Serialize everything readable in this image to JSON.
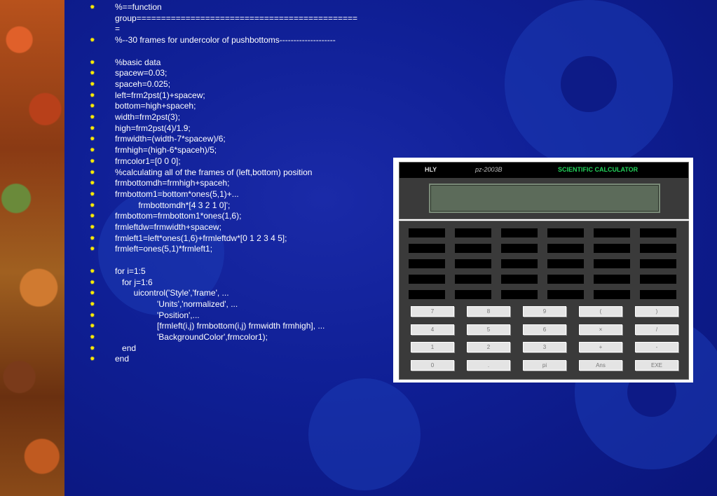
{
  "code_lines": [
    {
      "text": "%==function group=============================================",
      "bullet": true
    },
    {
      "text": "=",
      "bullet": false
    },
    {
      "text": "%--30 frames for undercolor of pushbottoms--------------------",
      "bullet": true
    },
    {
      "text": "",
      "bullet": false
    },
    {
      "text": "%basic data",
      "bullet": true
    },
    {
      "text": "spacew=0.03;",
      "bullet": true
    },
    {
      "text": "spaceh=0.025;",
      "bullet": true
    },
    {
      "text": "left=frm2pst(1)+spacew;",
      "bullet": true
    },
    {
      "text": "bottom=high+spaceh;",
      "bullet": true
    },
    {
      "text": "width=frm2pst(3);",
      "bullet": true
    },
    {
      "text": "high=frm2pst(4)/1.9;",
      "bullet": true
    },
    {
      "text": "frmwidth=(width-7*spacew)/6;",
      "bullet": true
    },
    {
      "text": "frmhigh=(high-6*spaceh)/5;",
      "bullet": true
    },
    {
      "text": "frmcolor1=[0 0 0];",
      "bullet": true
    },
    {
      "text": "%calculating all of the frames of (left,bottom) position",
      "bullet": true
    },
    {
      "text": "frmbottomdh=frmhigh+spaceh;",
      "bullet": true
    },
    {
      "text": "frmbottom1=bottom*ones(5,1)+...",
      "bullet": true
    },
    {
      "text": "          frmbottomdh*[4 3 2 1 0]';",
      "bullet": true
    },
    {
      "text": "frmbottom=frmbottom1*ones(1,6);",
      "bullet": true
    },
    {
      "text": "frmleftdw=frmwidth+spacew;",
      "bullet": true
    },
    {
      "text": "frmleft1=left*ones(1,6)+frmleftdw*[0 1 2 3 4 5];",
      "bullet": true
    },
    {
      "text": "frmleft=ones(5,1)*frmleft1;",
      "bullet": true
    },
    {
      "text": "",
      "bullet": false
    },
    {
      "text": "for i=1:5",
      "bullet": true
    },
    {
      "text": "   for j=1:6",
      "bullet": true
    },
    {
      "text": "        uicontrol('Style','frame', ...",
      "bullet": true
    },
    {
      "text": "                  'Units','normalized', ...",
      "bullet": true
    },
    {
      "text": "                  'Position',...",
      "bullet": true
    },
    {
      "text": "                  [frmleft(i,j) frmbottom(i,j) frmwidth frmhigh], ...",
      "bullet": true
    },
    {
      "text": "                  'BackgroundColor',frmcolor1);",
      "bullet": true
    },
    {
      "text": "   end",
      "bullet": true
    },
    {
      "text": "end",
      "bullet": true
    }
  ],
  "calculator": {
    "brand": "HLY",
    "model": "pz-2003B",
    "title": "SCIENTIFIC CALCULATOR",
    "frame_rows": 5,
    "frame_cols": 6,
    "frame_color": "#000000",
    "keys": [
      [
        "7",
        "8",
        "9",
        "(",
        ")"
      ],
      [
        "4",
        "5",
        "6",
        "×",
        "/"
      ],
      [
        "1",
        "2",
        "3",
        "+",
        "-"
      ],
      [
        "0",
        ".",
        "pi",
        "Ans",
        "EXE"
      ]
    ]
  },
  "colors": {
    "background": "#0f1f95",
    "bullet": "#ffee00",
    "text": "#ffffff",
    "calc_title": "#22d45a"
  },
  "icons": {
    "bullet": "sun-bullet-icon",
    "background": "gear-icon"
  }
}
